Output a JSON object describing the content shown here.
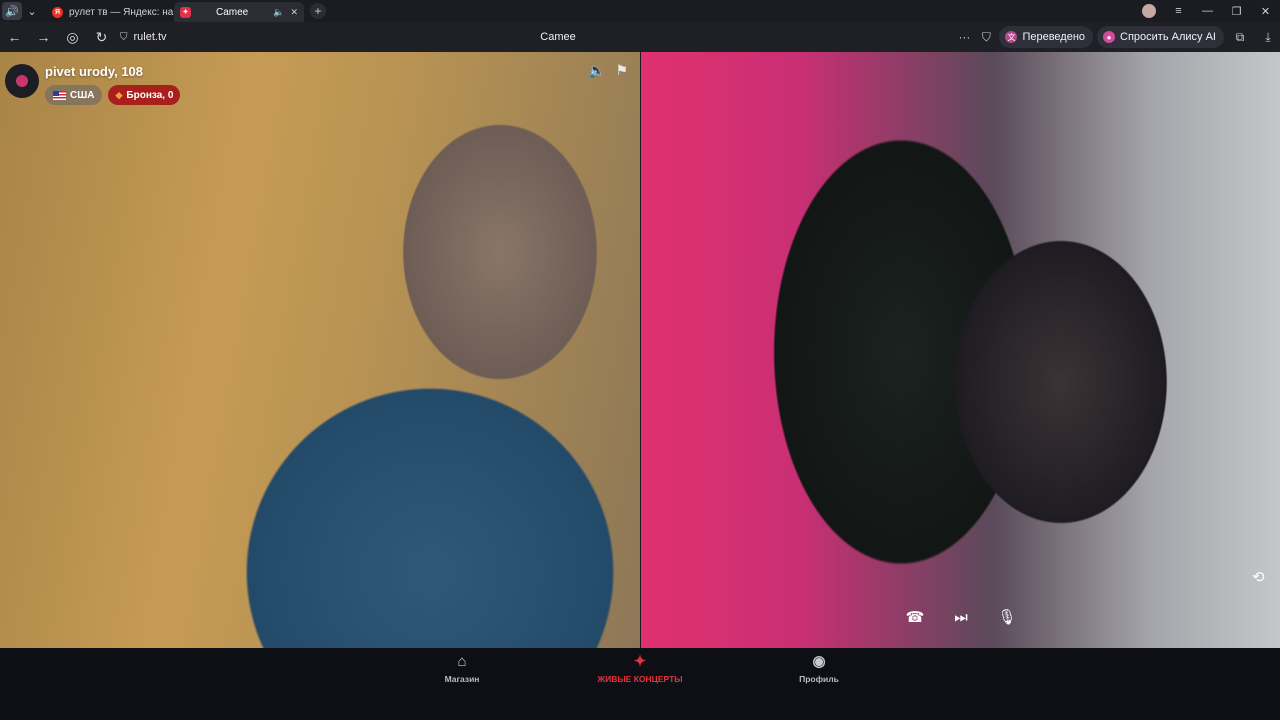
{
  "browser": {
    "tabs": [
      {
        "label": "рулет тв — Яндекс: нашл",
        "favicon": "yandex-icon",
        "active": false
      },
      {
        "label": "Camee",
        "favicon": "camee-icon",
        "active": true
      }
    ],
    "address": "rulet.tv",
    "page_title": "Camee",
    "translate_label": "Переведено",
    "ask_alice_label": "Спросить Алису AI"
  },
  "peer": {
    "name": "pivet urody, 108",
    "country": "США",
    "rank": "Бронза, 0"
  },
  "bottom_nav": [
    {
      "label": "Магазин",
      "icon": "shop-bag-icon",
      "active": false
    },
    {
      "label": "ЖИВЫЕ КОНЦЕРТЫ",
      "icon": "live-concerts-icon",
      "active": true
    },
    {
      "label": "Профиль",
      "icon": "profile-icon",
      "active": false
    }
  ],
  "colors": {
    "accent": "#e3343e",
    "rank_badge": "#a8201c",
    "background": "#0e0f14"
  }
}
